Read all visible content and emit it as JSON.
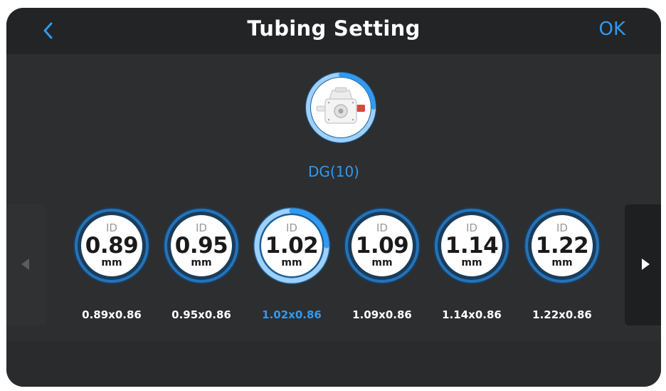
{
  "header": {
    "title": "Tubing Setting",
    "ok_label": "OK",
    "back_icon": "chevron-left-icon"
  },
  "pump": {
    "label": "DG(10)",
    "icon": "peristaltic-pump-image"
  },
  "tubes": [
    {
      "id_label": "ID",
      "value": "0.89",
      "unit": "mm",
      "label": "0.89x0.86"
    },
    {
      "id_label": "ID",
      "value": "0.95",
      "unit": "mm",
      "label": "0.95x0.86"
    },
    {
      "id_label": "ID",
      "value": "1.02",
      "unit": "mm",
      "label": "1.02x0.86"
    },
    {
      "id_label": "ID",
      "value": "1.09",
      "unit": "mm",
      "label": "1.09x0.86"
    },
    {
      "id_label": "ID",
      "value": "1.14",
      "unit": "mm",
      "label": "1.14x0.86"
    },
    {
      "id_label": "ID",
      "value": "1.22",
      "unit": "mm",
      "label": "1.22x0.86"
    }
  ],
  "selected_index": 2,
  "colors": {
    "accent": "#2f9af1",
    "background": "#2d2e30",
    "header": "#232425",
    "text": "#ffffff"
  },
  "nav": {
    "prev_icon": "arrow-left-icon",
    "next_icon": "arrow-right-icon"
  }
}
